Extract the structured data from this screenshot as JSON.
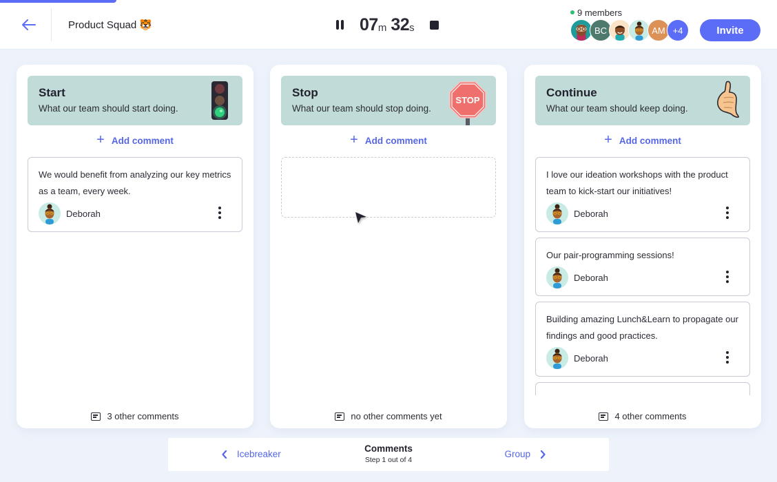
{
  "header": {
    "progress": 0.15,
    "team_name": "Product Squad 🐯",
    "timer": {
      "minutes": "07",
      "minutes_unit": "m",
      "seconds": "32",
      "seconds_unit": "s"
    },
    "members_label": "9 members",
    "avatars": [
      {
        "type": "image",
        "name": "bearded-man-avatar",
        "bg": "#1f9b9b"
      },
      {
        "type": "initials",
        "initials": "BC",
        "bg": "#4e7a6e"
      },
      {
        "type": "image",
        "name": "smiling-man-avatar",
        "bg": "#fbe3c8"
      },
      {
        "type": "image",
        "name": "deborah-avatar",
        "bg": "#c9ebe6"
      },
      {
        "type": "initials",
        "initials": "AM",
        "bg": "#dc9157"
      },
      {
        "type": "initials",
        "initials": "+4",
        "bg": "#5b6cf7"
      }
    ],
    "invite_label": "Invite"
  },
  "columns": [
    {
      "id": "start",
      "title": "Start",
      "subtitle": "What our team should start doing.",
      "illustration": "traffic-light-icon",
      "add_label": "Add comment",
      "comments": [
        {
          "text": "We would benefit from analyzing our key metrics as a team, every week.",
          "author": "Deborah"
        }
      ],
      "footer": "3 other comments"
    },
    {
      "id": "stop",
      "title": "Stop",
      "subtitle": "What our team should stop doing.",
      "illustration": "stop-sign-icon",
      "illustration_text": "STOP",
      "add_label": "Add comment",
      "comments": [],
      "footer": "no other comments yet"
    },
    {
      "id": "continue",
      "title": "Continue",
      "subtitle": "What our team should keep doing.",
      "illustration": "thumbs-up-icon",
      "add_label": "Add comment",
      "comments": [
        {
          "text": "I love our ideation workshops with the product team to kick-start our initiatives!",
          "author": "Deborah"
        },
        {
          "text": "Our pair-programming sessions!",
          "author": "Deborah"
        },
        {
          "text": "Building amazing Lunch&Learn to propagate our findings and good practices.",
          "author": "Deborah"
        }
      ],
      "footer": "4 other comments"
    }
  ],
  "stepper": {
    "prev_label": "Icebreaker",
    "title": "Comments",
    "subtitle": "Step 1 out of 4",
    "next_label": "Group"
  },
  "colors": {
    "accent": "#5b6cf7",
    "column_header_bg": "#c1dcd8",
    "background": "#eef3fb"
  }
}
